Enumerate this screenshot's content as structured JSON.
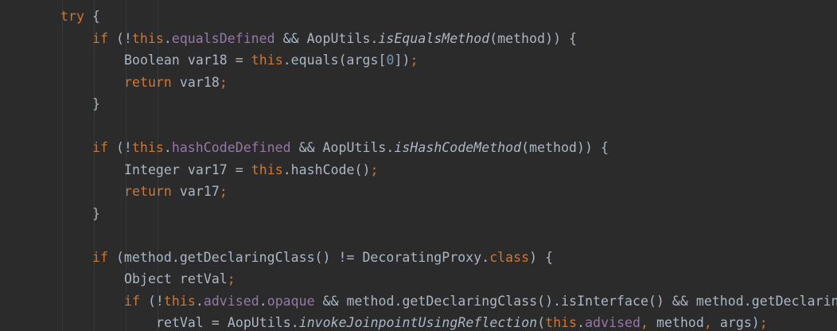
{
  "colors": {
    "background": "#2b2b2b",
    "default": "#a9b7c6",
    "keyword": "#cc7832",
    "field": "#9876aa",
    "static": "#a9b7c6",
    "number": "#6897bb",
    "indent_guide": "#393939"
  },
  "code": {
    "lines": [
      {
        "indent": 1,
        "tokens": [
          {
            "t": "try",
            "k": "keyword"
          },
          {
            "t": " {",
            "k": "default"
          }
        ]
      },
      {
        "indent": 2,
        "tokens": [
          {
            "t": "if",
            "k": "keyword"
          },
          {
            "t": " (!",
            "k": "default"
          },
          {
            "t": "this",
            "k": "keyword"
          },
          {
            "t": ".",
            "k": "default"
          },
          {
            "t": "equalsDefined",
            "k": "field"
          },
          {
            "t": " && AopUtils.",
            "k": "default"
          },
          {
            "t": "isEqualsMethod",
            "k": "static"
          },
          {
            "t": "(method)) {",
            "k": "default"
          }
        ]
      },
      {
        "indent": 3,
        "tokens": [
          {
            "t": "Boolean var18 = ",
            "k": "default"
          },
          {
            "t": "this",
            "k": "keyword"
          },
          {
            "t": ".equals(args[",
            "k": "default"
          },
          {
            "t": "0",
            "k": "number"
          },
          {
            "t": "])",
            "k": "default"
          },
          {
            "t": ";",
            "k": "keyword"
          }
        ]
      },
      {
        "indent": 3,
        "tokens": [
          {
            "t": "return",
            "k": "keyword"
          },
          {
            "t": " var18",
            "k": "default"
          },
          {
            "t": ";",
            "k": "keyword"
          }
        ]
      },
      {
        "indent": 2,
        "tokens": [
          {
            "t": "}",
            "k": "default"
          }
        ]
      },
      {
        "indent": 0,
        "tokens": []
      },
      {
        "indent": 2,
        "tokens": [
          {
            "t": "if",
            "k": "keyword"
          },
          {
            "t": " (!",
            "k": "default"
          },
          {
            "t": "this",
            "k": "keyword"
          },
          {
            "t": ".",
            "k": "default"
          },
          {
            "t": "hashCodeDefined",
            "k": "field"
          },
          {
            "t": " && AopUtils.",
            "k": "default"
          },
          {
            "t": "isHashCodeMethod",
            "k": "static"
          },
          {
            "t": "(method)) {",
            "k": "default"
          }
        ]
      },
      {
        "indent": 3,
        "tokens": [
          {
            "t": "Integer var17 = ",
            "k": "default"
          },
          {
            "t": "this",
            "k": "keyword"
          },
          {
            "t": ".hashCode()",
            "k": "default"
          },
          {
            "t": ";",
            "k": "keyword"
          }
        ]
      },
      {
        "indent": 3,
        "tokens": [
          {
            "t": "return",
            "k": "keyword"
          },
          {
            "t": " var17",
            "k": "default"
          },
          {
            "t": ";",
            "k": "keyword"
          }
        ]
      },
      {
        "indent": 2,
        "tokens": [
          {
            "t": "}",
            "k": "default"
          }
        ]
      },
      {
        "indent": 0,
        "tokens": []
      },
      {
        "indent": 2,
        "tokens": [
          {
            "t": "if",
            "k": "keyword"
          },
          {
            "t": " (method.getDeclaringClass() != DecoratingProxy.",
            "k": "default"
          },
          {
            "t": "class",
            "k": "keyword"
          },
          {
            "t": ") {",
            "k": "default"
          }
        ]
      },
      {
        "indent": 3,
        "tokens": [
          {
            "t": "Object retVal",
            "k": "default"
          },
          {
            "t": ";",
            "k": "keyword"
          }
        ]
      },
      {
        "indent": 3,
        "tokens": [
          {
            "t": "if",
            "k": "keyword"
          },
          {
            "t": " (!",
            "k": "default"
          },
          {
            "t": "this",
            "k": "keyword"
          },
          {
            "t": ".",
            "k": "default"
          },
          {
            "t": "advised",
            "k": "field"
          },
          {
            "t": ".",
            "k": "default"
          },
          {
            "t": "opaque",
            "k": "field"
          },
          {
            "t": " && method.getDeclaringClass().isInterface() && method.getDeclarin",
            "k": "default"
          }
        ]
      },
      {
        "indent": 4,
        "tokens": [
          {
            "t": "retVal = AopUtils.",
            "k": "default"
          },
          {
            "t": "invokeJoinpointUsingReflection",
            "k": "static"
          },
          {
            "t": "(",
            "k": "default"
          },
          {
            "t": "this",
            "k": "keyword"
          },
          {
            "t": ".",
            "k": "default"
          },
          {
            "t": "advised",
            "k": "field"
          },
          {
            "t": ", ",
            "k": "keyword"
          },
          {
            "t": "method",
            "k": "default"
          },
          {
            "t": ", ",
            "k": "keyword"
          },
          {
            "t": "args)",
            "k": "default"
          },
          {
            "t": ";",
            "k": "keyword"
          }
        ]
      }
    ]
  }
}
